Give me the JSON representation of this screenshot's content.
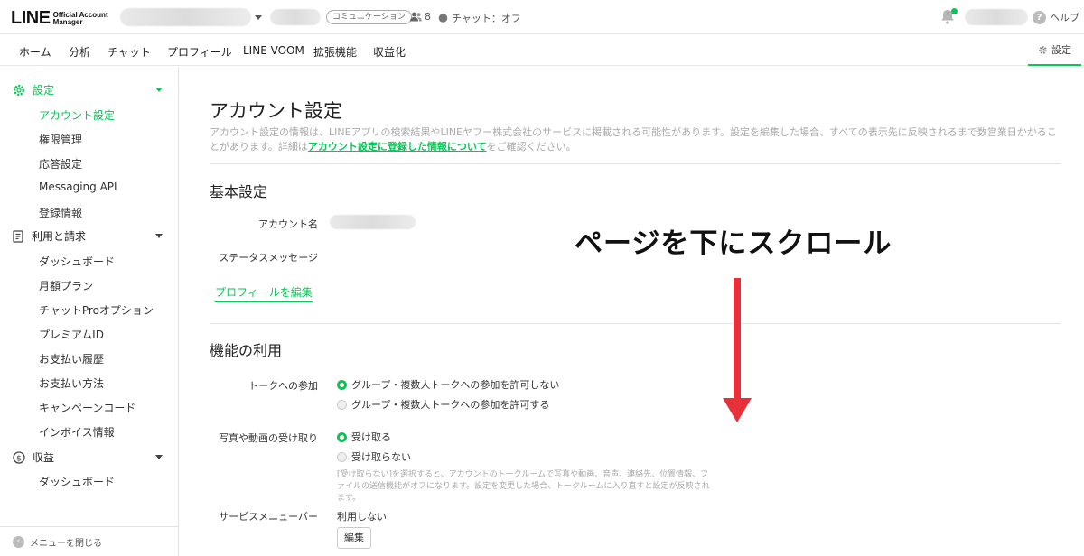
{
  "header": {
    "logo_main": "LINE",
    "logo_sub_1": "Official Account",
    "logo_sub_2": "Manager",
    "account_type_badge": "コミュニケーション",
    "friends_count": "8",
    "chat_status": "チャット：オフ",
    "help_label": "ヘルプ",
    "notification_dot_color": "#06c755"
  },
  "nav": {
    "items": [
      "ホーム",
      "分析",
      "チャット",
      "プロフィール",
      "LINE VOOM",
      "拡張機能",
      "収益化"
    ],
    "settings_label": "設定"
  },
  "sidebar": {
    "group_settings": "設定",
    "settings_items": [
      "アカウント設定",
      "権限管理",
      "応答設定",
      "Messaging API",
      "登録情報"
    ],
    "group_billing": "利用と請求",
    "billing_items": [
      "ダッシュボード",
      "月額プラン",
      "チャットProオプション",
      "プレミアムID",
      "お支払い履歴",
      "お支払い方法",
      "キャンペーンコード",
      "インボイス情報"
    ],
    "group_revenue": "収益",
    "revenue_items": [
      "ダッシュボード"
    ],
    "close_menu": "メニューを閉じる",
    "active_item": "アカウント設定"
  },
  "main": {
    "page_title": "アカウント設定",
    "desc_1": "アカウント設定の情報は、LINEアプリの検索結果やLINEヤフー株式会社のサービスに掲載される可能性があります。設定を編集した場合、すべての表示先に反映されるまで数営業日かかることがあります。詳細は",
    "desc_link": "アカウント設定に登録した情報について",
    "desc_2": "をご確認ください。",
    "basic_title": "基本設定",
    "account_name_label": "アカウント名",
    "status_message_label": "ステータスメッセージ",
    "edit_profile_link": "プロフィールを編集",
    "features_title": "機能の利用",
    "talk_join_label": "トークへの参加",
    "talk_join_options": [
      "グループ・複数人トークへの参加を許可しない",
      "グループ・複数人トークへの参加を許可する"
    ],
    "talk_join_selected": 0,
    "media_label": "写真や動画の受け取り",
    "media_options": [
      "受け取る",
      "受け取らない"
    ],
    "media_selected": 0,
    "media_note": "[受け取らない]を選択すると、アカウントのトークルームで写真や動画、音声、連絡先、位置情報、ファイルの送信機能がオフになります。設定を変更した場合、トークルームに入り直すと設定が反映されます。",
    "service_menu_label": "サービスメニューバー",
    "service_menu_value": "利用しない",
    "edit_button": "編集"
  },
  "overlay": {
    "scroll_hint": "ページを下にスクロール",
    "arrow_color": "#e8303a"
  },
  "colors": {
    "accent": "#06c755"
  }
}
